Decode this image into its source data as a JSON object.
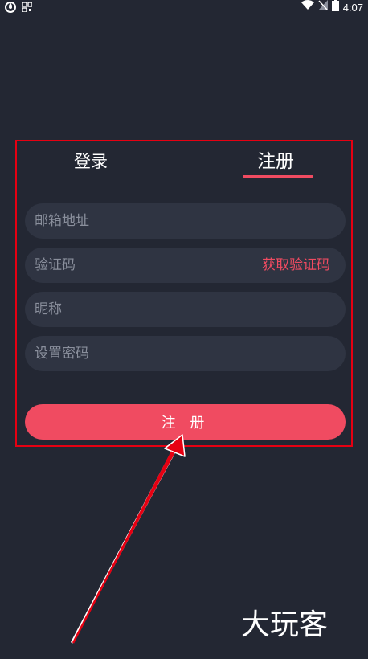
{
  "status_bar": {
    "time": "4:07"
  },
  "tabs": {
    "login_label": "登录",
    "register_label": "注册",
    "active": "register"
  },
  "form": {
    "email_placeholder": "邮箱地址",
    "code_placeholder": "验证码",
    "get_code_label": "获取验证码",
    "nickname_placeholder": "昵称",
    "password_placeholder": "设置密码",
    "submit_label": "注 册"
  },
  "watermark": {
    "text": "大玩客"
  },
  "colors": {
    "background": "#232733",
    "field_background": "#2f3442",
    "accent": "#f04b61",
    "annotation_red": "#e60012"
  }
}
